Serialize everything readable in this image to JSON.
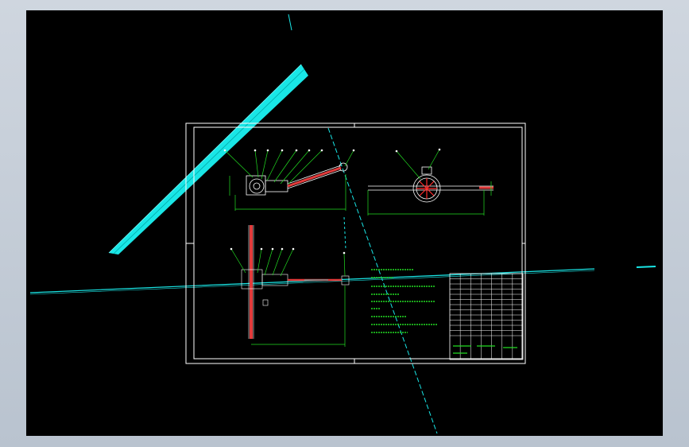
{
  "colors": {
    "background": "#000000",
    "frame": "#ffffff",
    "cyan": "#19e6e6",
    "green": "#22dd22",
    "red": "#e23b3b",
    "accent_red": "#ff2a2a"
  },
  "title_block": {
    "rows": 12,
    "cols": 7
  }
}
